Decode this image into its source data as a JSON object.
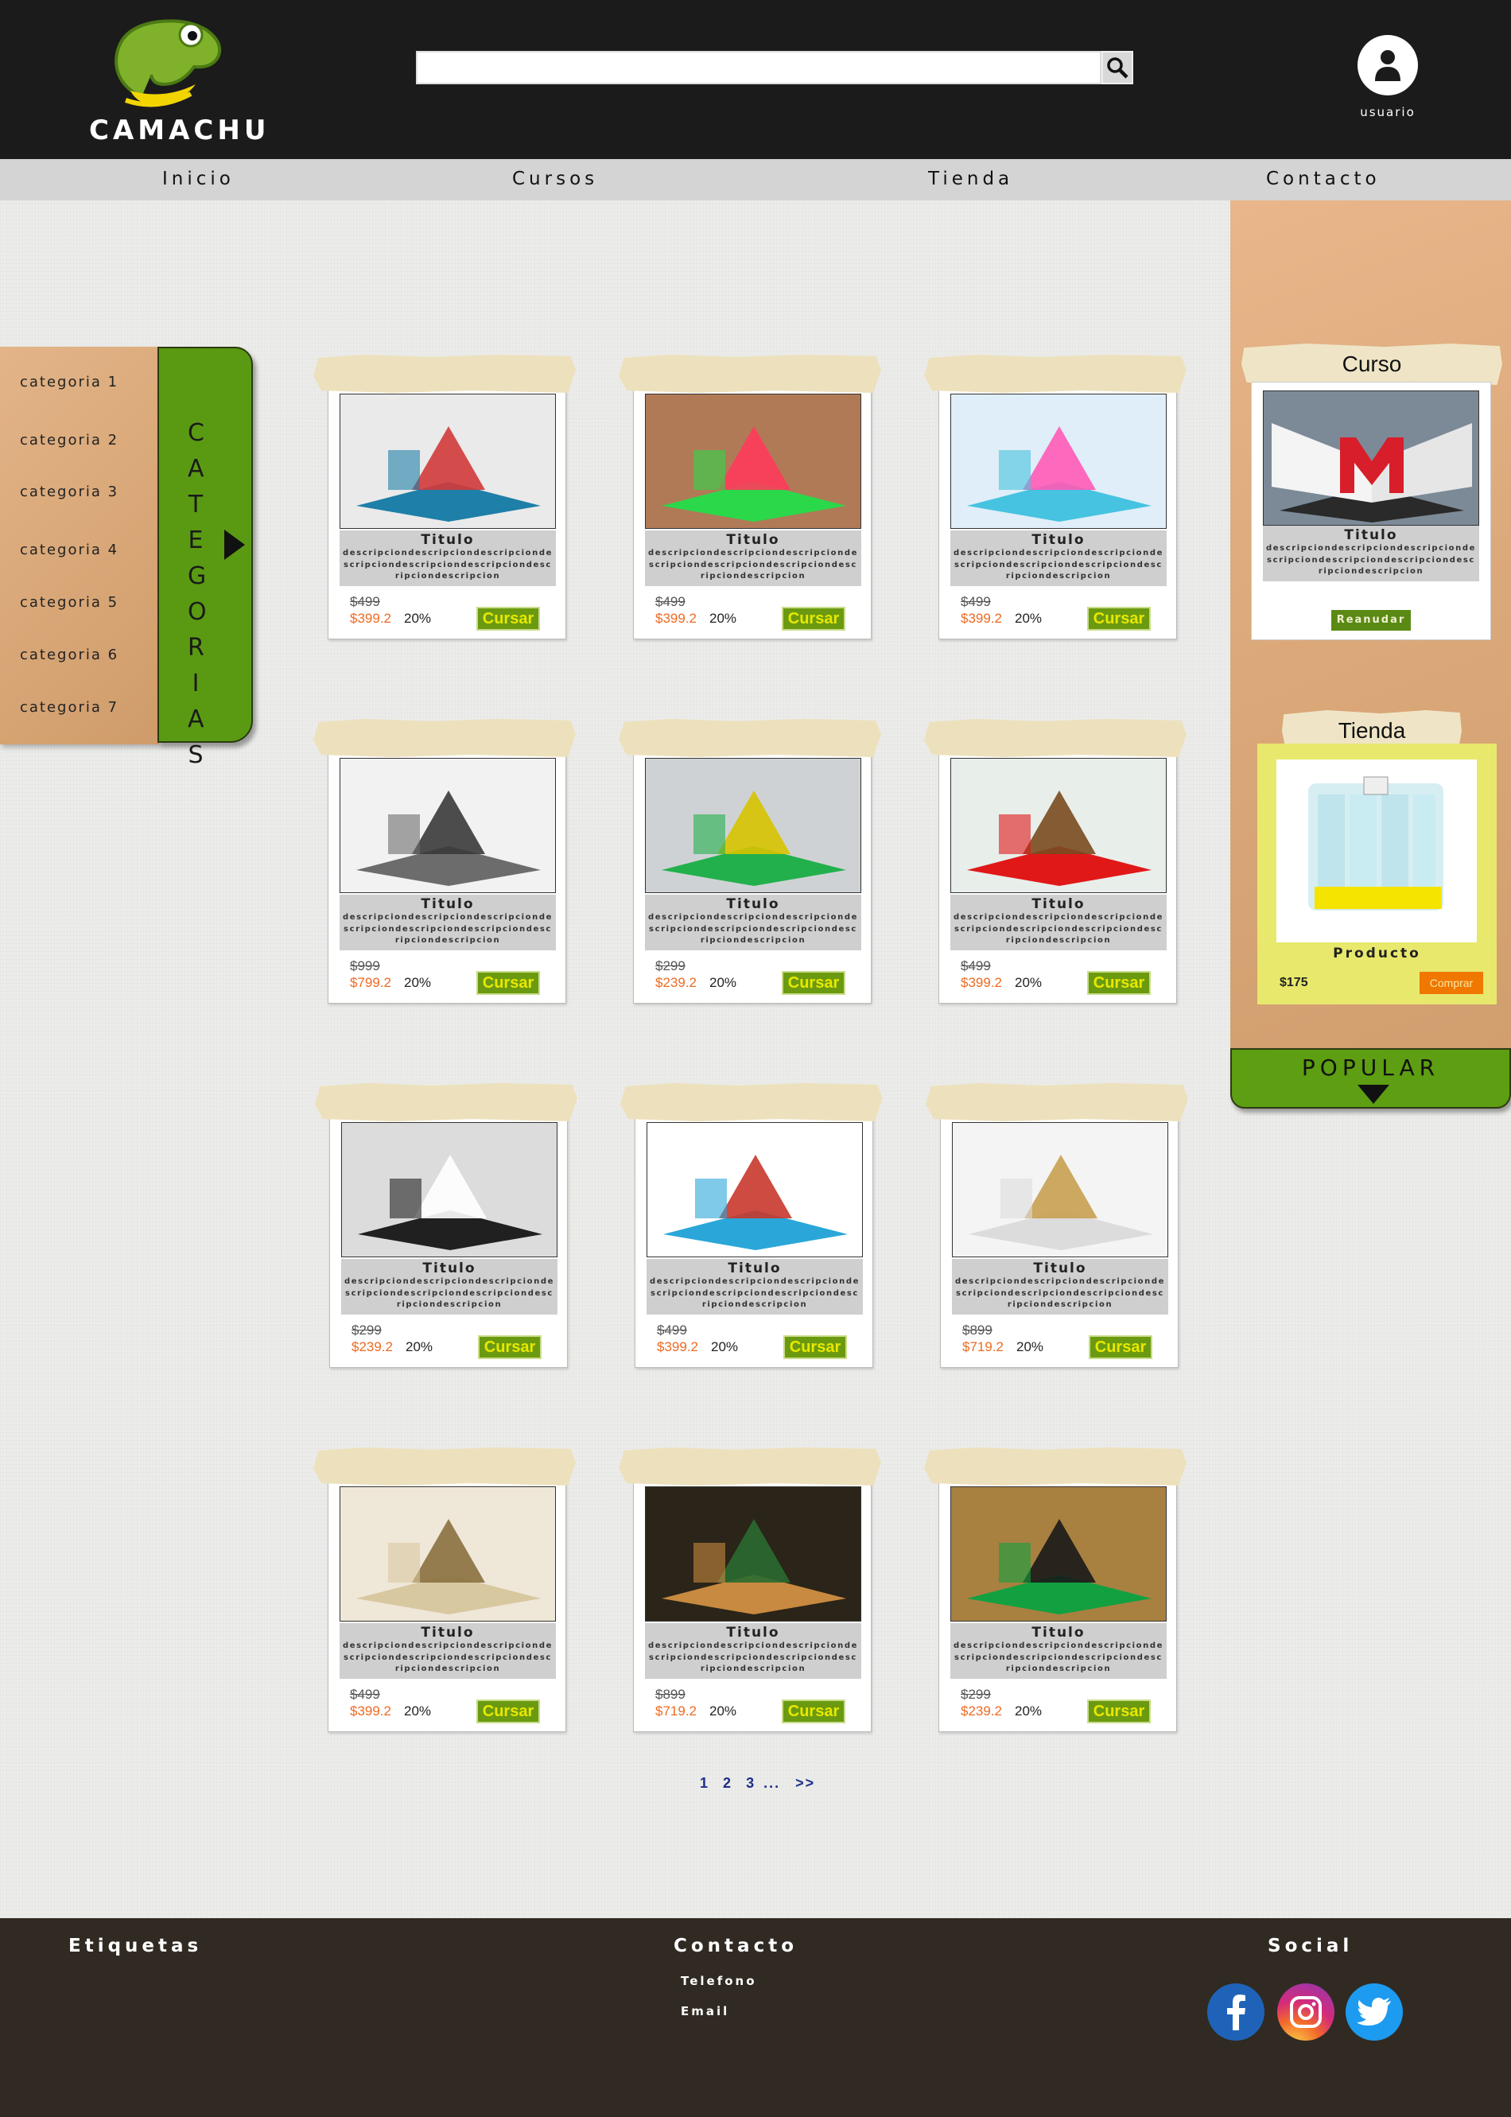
{
  "brand": {
    "name": "CAMACHU"
  },
  "search": {
    "value": "",
    "placeholder": ""
  },
  "user": {
    "label": "usuario"
  },
  "nav": {
    "items": [
      "Inicio",
      "Cursos",
      "Tienda",
      "Contacto"
    ]
  },
  "categories": {
    "tab_label": "CATEGORIAS",
    "items": [
      "categoria 1",
      "categoria 2",
      "categoria 3",
      "categoria 4",
      "categoria 5",
      "categoria 6",
      "categoria 7"
    ]
  },
  "products": [
    {
      "title": "Titulo",
      "desc": "descripciondescripciondescripciondescripciondescripciondescripciondescripciondescripcion",
      "old_price": "$499",
      "new_price": "$399.2",
      "discount": "20%",
      "button": "Cursar"
    },
    {
      "title": "Titulo",
      "desc": "descripciondescripciondescripciondescripciondescripciondescripciondescripciondescripcion",
      "old_price": "$499",
      "new_price": "$399.2",
      "discount": "20%",
      "button": "Cursar"
    },
    {
      "title": "Titulo",
      "desc": "descripciondescripciondescripciondescripciondescripciondescripciondescripciondescripcion",
      "old_price": "$499",
      "new_price": "$399.2",
      "discount": "20%",
      "button": "Cursar"
    },
    {
      "title": "Titulo",
      "desc": "descripciondescripciondescripciondescripciondescripciondescripciondescripciondescripcion",
      "old_price": "$999",
      "new_price": "$799.2",
      "discount": "20%",
      "button": "Cursar"
    },
    {
      "title": "Titulo",
      "desc": "descripciondescripciondescripciondescripciondescripciondescripciondescripciondescripcion",
      "old_price": "$299",
      "new_price": "$239.2",
      "discount": "20%",
      "button": "Cursar"
    },
    {
      "title": "Titulo",
      "desc": "descripciondescripciondescripciondescripciondescripciondescripciondescripciondescripcion",
      "old_price": "$499",
      "new_price": "$399.2",
      "discount": "20%",
      "button": "Cursar"
    },
    {
      "title": "Titulo",
      "desc": "descripciondescripciondescripciondescripciondescripciondescripciondescripciondescripcion",
      "old_price": "$299",
      "new_price": "$239.2",
      "discount": "20%",
      "button": "Cursar"
    },
    {
      "title": "Titulo",
      "desc": "descripciondescripciondescripciondescripciondescripciondescripciondescripciondescripcion",
      "old_price": "$499",
      "new_price": "$399.2",
      "discount": "20%",
      "button": "Cursar"
    },
    {
      "title": "Titulo",
      "desc": "descripciondescripciondescripciondescripciondescripciondescripciondescripciondescripcion",
      "old_price": "$899",
      "new_price": "$719.2",
      "discount": "20%",
      "button": "Cursar"
    },
    {
      "title": "Titulo",
      "desc": "descripciondescripciondescripciondescripciondescripciondescripciondescripciondescripcion",
      "old_price": "$499",
      "new_price": "$399.2",
      "discount": "20%",
      "button": "Cursar"
    },
    {
      "title": "Titulo",
      "desc": "descripciondescripciondescripciondescripciondescripciondescripciondescripciondescripcion",
      "old_price": "$899",
      "new_price": "$719.2",
      "discount": "20%",
      "button": "Cursar"
    },
    {
      "title": "Titulo",
      "desc": "descripciondescripciondescripciondescripciondescripciondescripciondescripciondescripcion",
      "old_price": "$299",
      "new_price": "$239.2",
      "discount": "20%",
      "button": "Cursar"
    }
  ],
  "sidebar": {
    "curso": {
      "heading": "Curso",
      "title": "Titulo",
      "desc": "descripciondescripciondescripciondescripciondescripciondescripciondescripciondescripcion",
      "button": "Reanudar"
    },
    "tienda": {
      "heading": "Tienda",
      "product": "Producto",
      "price": "$175",
      "button": "Comprar"
    },
    "popular": "POPULAR"
  },
  "pagination": {
    "pages": [
      "1",
      "2",
      "3"
    ],
    "ellipsis": "...",
    "next": ">>"
  },
  "footer": {
    "etiquetas": "Etiquetas",
    "contacto": {
      "heading": "Contacto",
      "links": [
        "Telefono",
        "Email"
      ]
    },
    "social": {
      "heading": "Social",
      "networks": [
        "facebook-icon",
        "instagram-icon",
        "twitter-icon"
      ]
    }
  },
  "colors": {
    "accent_green": "#5a9a12",
    "header": "#1b1b1b",
    "footer": "#302a23",
    "price": "#ee6a22",
    "tan": "#dba87a"
  }
}
